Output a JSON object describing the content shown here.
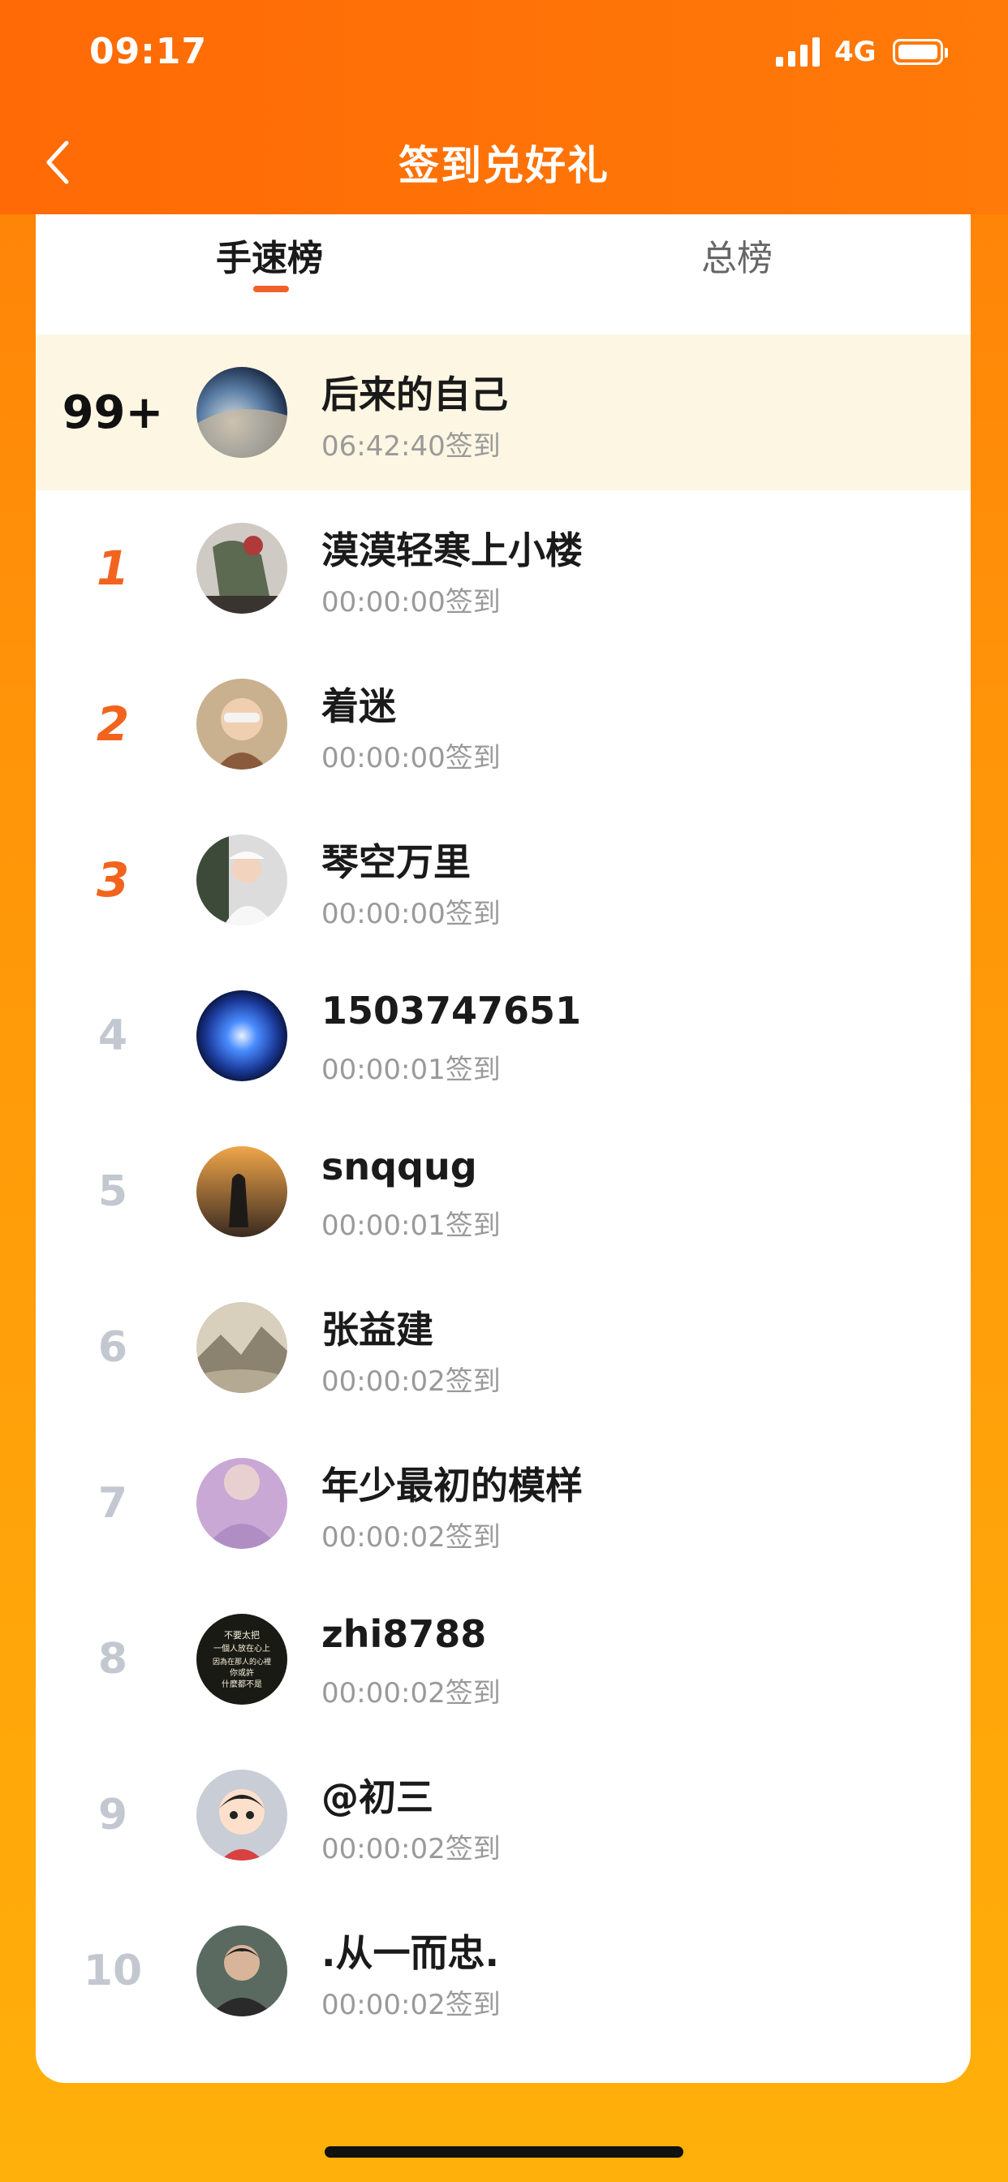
{
  "status_bar": {
    "time": "09:17",
    "network": "4G"
  },
  "nav": {
    "title": "签到兑好礼"
  },
  "tabs": [
    {
      "label": "手速榜",
      "active": true
    },
    {
      "label": "总榜",
      "active": false
    }
  ],
  "my_entry": {
    "rank": "99+",
    "name": "后来的自己",
    "signin": "06:42:40签到"
  },
  "entries": [
    {
      "rank": "1",
      "name": "漠漠轻寒上小楼",
      "signin": "00:00:00签到"
    },
    {
      "rank": "2",
      "name": "着迷",
      "signin": "00:00:00签到"
    },
    {
      "rank": "3",
      "name": "琴空万里",
      "signin": "00:00:00签到"
    },
    {
      "rank": "4",
      "name": "1503747651",
      "signin": "00:00:01签到"
    },
    {
      "rank": "5",
      "name": "snqqug",
      "signin": "00:00:01签到"
    },
    {
      "rank": "6",
      "name": "张益建",
      "signin": "00:00:02签到"
    },
    {
      "rank": "7",
      "name": "年少最初的模样",
      "signin": "00:00:02签到"
    },
    {
      "rank": "8",
      "name": "zhi8788",
      "signin": "00:00:02签到"
    },
    {
      "rank": "9",
      "name": "@初三",
      "signin": "00:00:02签到"
    },
    {
      "rank": "10",
      "name": ".从一而忠.",
      "signin": "00:00:02签到"
    }
  ],
  "avatar_8_text": [
    "不要太把",
    "一個人放在心上",
    "因為在那人的心裡",
    "你或許",
    "什麼都不是"
  ],
  "colors": {
    "accent": "#f0602a",
    "header": "#ff6d06",
    "background_bottom": "#ffb00a",
    "my_row_bg": "#fdf6e2"
  }
}
